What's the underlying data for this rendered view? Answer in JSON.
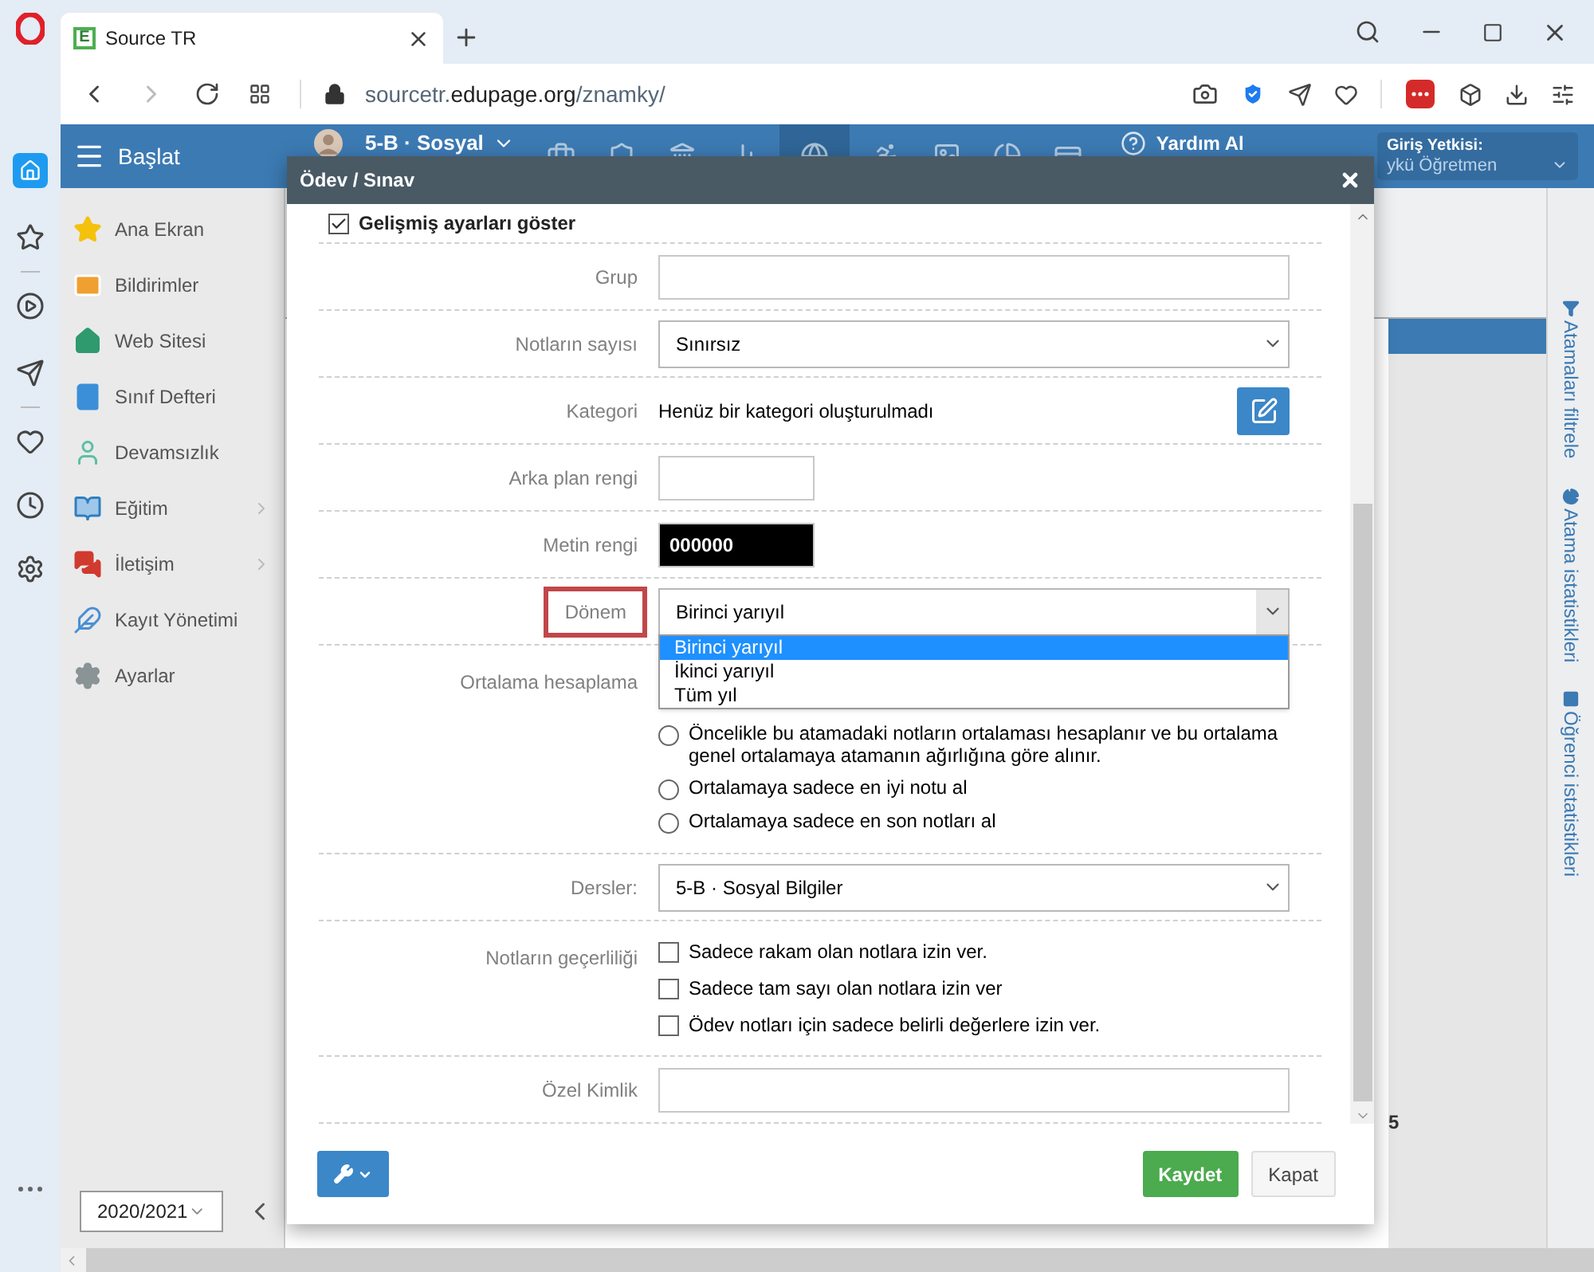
{
  "browser": {
    "favicon_letter": "E",
    "tab_title": "Source TR",
    "url_host": "sourcetr.",
    "url_domain": "edupage.org",
    "url_path": "/znamky/"
  },
  "header": {
    "menu_label": "Başlat",
    "class_label": "5-B · Sosyal",
    "help_label": "Yardım Al",
    "login_label": "Giriş Yetkisi:",
    "login_value": "ykü Öğretmen"
  },
  "sidebar": {
    "items": [
      {
        "label": "Ana Ekran",
        "has_children": false
      },
      {
        "label": "Bildirimler",
        "has_children": false
      },
      {
        "label": "Web Sitesi",
        "has_children": false
      },
      {
        "label": "Sınıf Defteri",
        "has_children": false
      },
      {
        "label": "Devamsızlık",
        "has_children": false
      },
      {
        "label": "Eğitim",
        "has_children": true
      },
      {
        "label": "İletişim",
        "has_children": true
      },
      {
        "label": "Kayıt Yönetimi",
        "has_children": false
      },
      {
        "label": "Ayarlar",
        "has_children": false
      }
    ],
    "year": "2020/2021"
  },
  "main": {
    "visible_cell": "5"
  },
  "right_tabs": [
    {
      "label": "Atamaları filtrele"
    },
    {
      "label": "Atama istatistikleri"
    },
    {
      "label": "Öğrenci istatistikleri"
    }
  ],
  "dialog": {
    "title": "Ödev / Sınav",
    "advanced": {
      "label": "Gelişmiş ayarları göster",
      "checked": true
    },
    "fields": [
      {
        "kind": "text",
        "label": "Grup",
        "highlighted": false
      },
      {
        "kind": "select",
        "label": "Notların sayısı",
        "value": "Sınırsız",
        "highlighted": false
      },
      {
        "kind": "info",
        "label": "Kategori",
        "value": "Henüz bir kategori oluşturulmadı",
        "highlighted": false
      },
      {
        "kind": "color",
        "label": "Arka plan rengi",
        "color": "#ffffff",
        "highlighted": false
      },
      {
        "kind": "color",
        "label": "Metin rengi",
        "value": "000000",
        "color": "#000000",
        "highlighted": false
      },
      {
        "kind": "select",
        "label": "Dönem",
        "value": "Birinci yarıyıl",
        "highlighted": true,
        "open": true,
        "options": [
          {
            "label": "Birinci yarıyıl",
            "selected": true
          },
          {
            "label": "İkinci yarıyıl",
            "selected": false
          },
          {
            "label": "Tüm yıl",
            "selected": false
          }
        ]
      },
      {
        "kind": "radios",
        "label": "Ortalama hesaplama",
        "highlighted": false,
        "options": [
          {
            "label": "Öncelikle bu atamadaki notların ortalaması hesaplanır ve bu ortalama genel ortalamaya atamanın ağırlığına göre alınır.",
            "selected": false
          },
          {
            "label": "Ortalamaya sadece en iyi notu al",
            "selected": false
          },
          {
            "label": "Ortalamaya sadece en son notları al",
            "selected": false
          }
        ]
      },
      {
        "kind": "select",
        "label": "Dersler:",
        "value": "5-B · Sosyal Bilgiler",
        "highlighted": false
      },
      {
        "kind": "checks",
        "label": "Notların geçerliliği",
        "highlighted": false,
        "options": [
          {
            "label": "Sadece rakam olan notlara izin ver.",
            "checked": false
          },
          {
            "label": "Sadece tam sayı olan notlara izin ver",
            "checked": false
          },
          {
            "label": "Ödev notları için sadece belirli değerlere izin ver.",
            "checked": false
          }
        ]
      },
      {
        "kind": "text",
        "label": "Özel Kimlik",
        "highlighted": false
      }
    ],
    "save_label": "Kaydet",
    "close_label": "Kapat"
  }
}
